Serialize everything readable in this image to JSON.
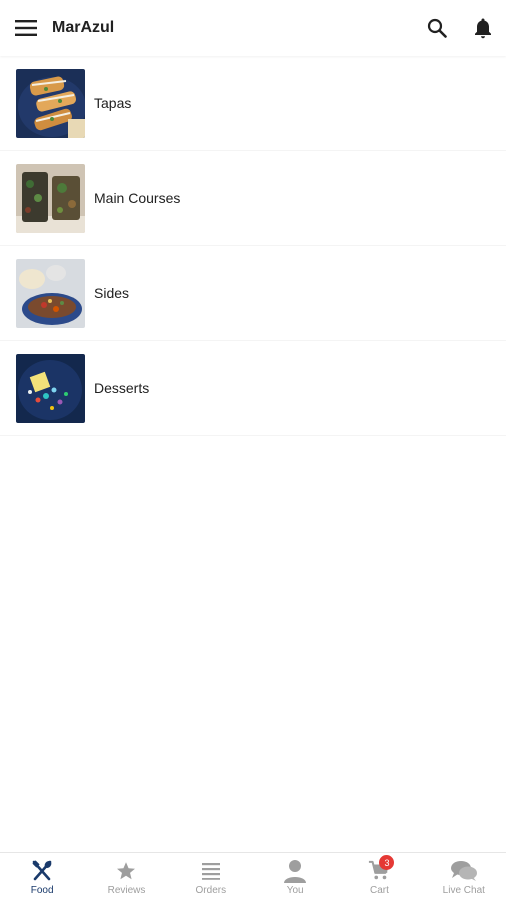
{
  "header": {
    "title": "MarAzul",
    "menu_icon": "hamburger-menu-icon",
    "search_icon": "search-icon",
    "notification_icon": "bell-icon"
  },
  "categories": [
    {
      "label": "Tapas",
      "image": "tapas-photo"
    },
    {
      "label": "Main Courses",
      "image": "main-courses-photo"
    },
    {
      "label": "Sides",
      "image": "sides-photo"
    },
    {
      "label": "Desserts",
      "image": "desserts-photo"
    }
  ],
  "bottom_nav": {
    "items": [
      {
        "label": "Food",
        "icon": "fork-spoon-icon",
        "active": true
      },
      {
        "label": "Reviews",
        "icon": "star-icon"
      },
      {
        "label": "Orders",
        "icon": "list-icon"
      },
      {
        "label": "You",
        "icon": "person-icon"
      },
      {
        "label": "Cart",
        "icon": "cart-icon",
        "badge": "3"
      },
      {
        "label": "Live Chat",
        "icon": "chat-icon"
      }
    ]
  },
  "colors": {
    "active_nav": "#1a3a6b",
    "inactive_nav": "#9e9e9e",
    "badge": "#e53935"
  }
}
